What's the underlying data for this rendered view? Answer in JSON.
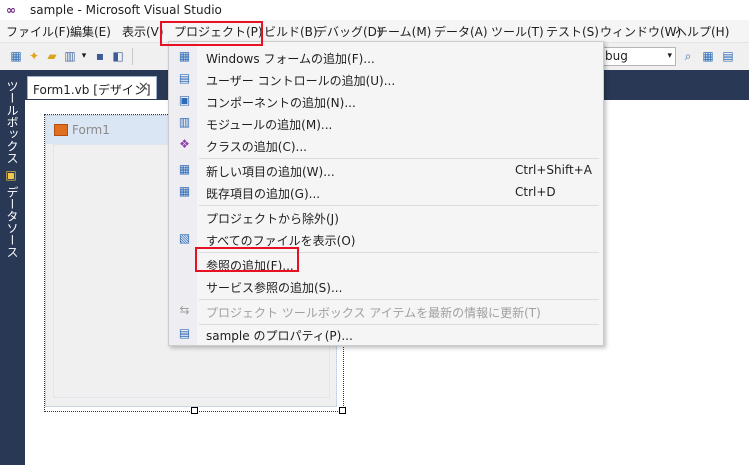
{
  "window": {
    "title": "sample - Microsoft Visual Studio",
    "logo": "vs-infinity-logo"
  },
  "menubar": {
    "items": [
      "ファイル(F)",
      "編集(E)",
      "表示(V)",
      "プロジェクト(P)",
      "ビルド(B)",
      "デバッグ(D)",
      "チーム(M)",
      "データ(A)",
      "ツール(T)",
      "テスト(S)",
      "ウィンドウ(W)",
      "ヘルプ(H)"
    ]
  },
  "toolbar": {
    "config_value": "bug",
    "config_arrow": "▾"
  },
  "sidebar": {
    "toolbox": "ツールボックス",
    "datasource": "データソース"
  },
  "doc_tab": {
    "label": "Form1.vb [デザイン]",
    "close": "✕"
  },
  "form": {
    "caption": "Form1"
  },
  "project_menu": {
    "items": [
      {
        "label": "Windows フォームの追加(F)...",
        "shortcut": "",
        "icon": "add-form-icon",
        "glyph": "▦",
        "disabled": false
      },
      {
        "label": "ユーザー コントロールの追加(U)...",
        "shortcut": "",
        "icon": "add-user-control-icon",
        "glyph": "▤",
        "disabled": false
      },
      {
        "label": "コンポーネントの追加(N)...",
        "shortcut": "",
        "icon": "add-component-icon",
        "glyph": "▣",
        "disabled": false
      },
      {
        "label": "モジュールの追加(M)...",
        "shortcut": "",
        "icon": "add-module-icon",
        "glyph": "▥",
        "disabled": false
      },
      {
        "label": "クラスの追加(C)...",
        "shortcut": "",
        "icon": "add-class-icon",
        "glyph": "❖",
        "disabled": false
      },
      {
        "label": "新しい項目の追加(W)...",
        "shortcut": "Ctrl+Shift+A",
        "icon": "new-item-icon",
        "glyph": "▦",
        "disabled": false
      },
      {
        "label": "既存項目の追加(G)...",
        "shortcut": "Ctrl+D",
        "icon": "existing-item-icon",
        "glyph": "▦",
        "disabled": false
      },
      {
        "label": "プロジェクトから除外(J)",
        "shortcut": "",
        "icon": "",
        "glyph": "",
        "disabled": false
      },
      {
        "label": "すべてのファイルを表示(O)",
        "shortcut": "",
        "icon": "show-all-files-icon",
        "glyph": "▧",
        "disabled": false
      },
      {
        "label": "参照の追加(F)...",
        "shortcut": "",
        "icon": "",
        "glyph": "",
        "disabled": false
      },
      {
        "label": "サービス参照の追加(S)...",
        "shortcut": "",
        "icon": "",
        "glyph": "",
        "disabled": false
      },
      {
        "label": "プロジェクト ツールボックス アイテムを最新の情報に更新(T)",
        "shortcut": "",
        "icon": "refresh-toolbox-icon",
        "glyph": "⇆",
        "disabled": true
      },
      {
        "label": "sample のプロパティ(P)...",
        "shortcut": "",
        "icon": "properties-icon",
        "glyph": "▤",
        "disabled": false
      }
    ]
  },
  "colors": {
    "highlight": "#e81123",
    "chrome_dark": "#293955"
  }
}
